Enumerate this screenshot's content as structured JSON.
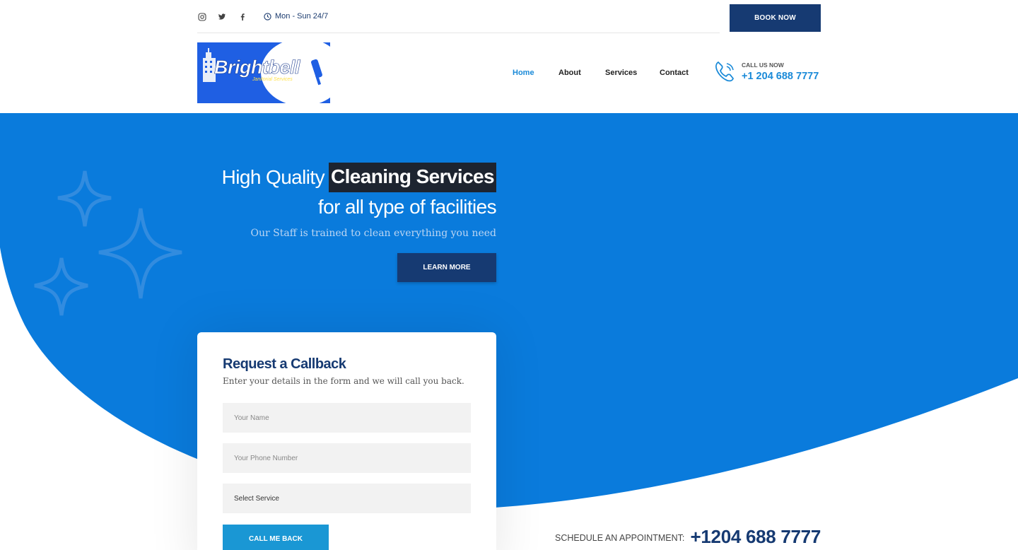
{
  "topbar": {
    "social": [
      "instagram-icon",
      "twitter-icon",
      "facebook-icon"
    ],
    "hours_icon": "clock-icon",
    "hours": "Mon - Sun 24/7",
    "book_label": "BOOK NOW"
  },
  "logo": {
    "name": "Brightbell",
    "tagline": "Janitorial Services"
  },
  "nav": {
    "items": [
      {
        "label": "Home",
        "active": true
      },
      {
        "label": "About",
        "active": false
      },
      {
        "label": "Services",
        "active": false
      },
      {
        "label": "Contact",
        "active": false
      }
    ]
  },
  "call": {
    "icon": "phone-icon",
    "label": "CALL US NOW",
    "number": "+1 204 688 7777"
  },
  "hero": {
    "title_prefix": "High Quality",
    "title_highlight": "Cleaning Services",
    "title_line2": "for all type of facilities",
    "subtitle": "Our Staff is trained to clean everything you need",
    "cta_label": "LEARN MORE"
  },
  "form": {
    "title": "Request a Callback",
    "subtitle": "Enter your details in the form and we will call you back.",
    "name_placeholder": "Your Name",
    "phone_placeholder": "Your Phone Number",
    "service_selected": "Select Service",
    "submit_label": "CALL ME BACK"
  },
  "schedule": {
    "label": "SCHEDULE AN APPOINTMENT:",
    "number": "+1204 688 7777"
  },
  "colors": {
    "primary_dark": "#163a72",
    "hero_blue": "#0a7bdc",
    "accent_blue": "#1a8ad8",
    "highlight_bg": "#1d2430"
  }
}
